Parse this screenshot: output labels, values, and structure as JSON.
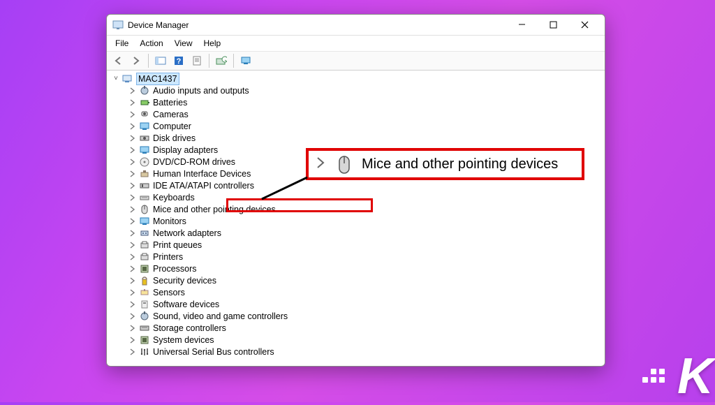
{
  "window": {
    "title": "Device Manager",
    "menu": [
      "File",
      "Action",
      "View",
      "Help"
    ]
  },
  "toolbar": {
    "back": "◄",
    "forward": "►"
  },
  "root": {
    "label": "MAC1437"
  },
  "devices": [
    {
      "label": "Audio inputs and outputs"
    },
    {
      "label": "Batteries"
    },
    {
      "label": "Cameras"
    },
    {
      "label": "Computer"
    },
    {
      "label": "Disk drives"
    },
    {
      "label": "Display adapters"
    },
    {
      "label": "DVD/CD-ROM drives"
    },
    {
      "label": "Human Interface Devices"
    },
    {
      "label": "IDE ATA/ATAPI controllers"
    },
    {
      "label": "Keyboards"
    },
    {
      "label": "Mice and other pointing devices",
      "highlight": true
    },
    {
      "label": "Monitors"
    },
    {
      "label": "Network adapters"
    },
    {
      "label": "Print queues"
    },
    {
      "label": "Printers"
    },
    {
      "label": "Processors"
    },
    {
      "label": "Security devices"
    },
    {
      "label": "Sensors"
    },
    {
      "label": "Software devices"
    },
    {
      "label": "Sound, video and game controllers"
    },
    {
      "label": "Storage controllers"
    },
    {
      "label": "System devices"
    },
    {
      "label": "Universal Serial Bus controllers"
    }
  ],
  "callout": {
    "label": "Mice and other pointing devices"
  },
  "watermark": "K"
}
